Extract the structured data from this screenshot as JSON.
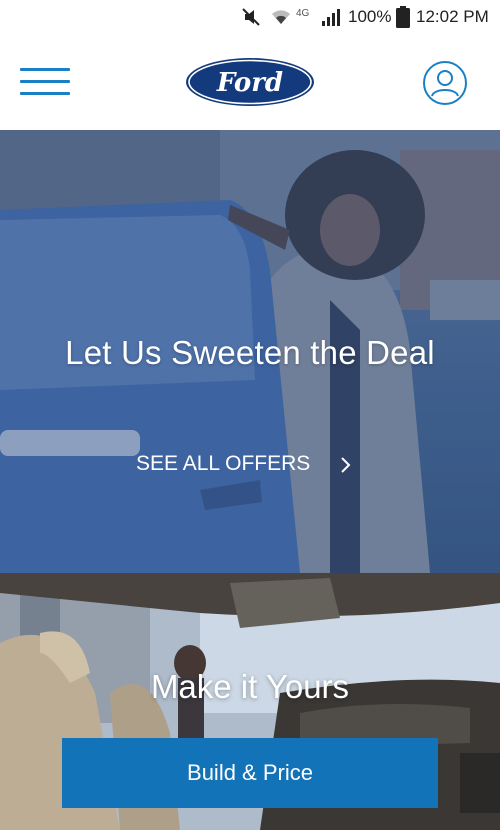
{
  "status_bar": {
    "network_label": "4G",
    "battery_percent": "100%",
    "time": "12:02 PM",
    "icons": [
      "mute-icon",
      "wifi-icon",
      "signal-icon",
      "battery-icon"
    ]
  },
  "header": {
    "logo_text": "Ford",
    "icons": [
      "menu-icon",
      "account-icon"
    ],
    "brand_color": "#1a80c4",
    "logo_color": "#133a7c"
  },
  "hero_offers": {
    "title": "Let Us Sweeten the Deal",
    "link_label": "SEE ALL OFFERS",
    "link_icon": "chevron-right-icon"
  },
  "hero_build": {
    "title": "Make it Yours",
    "button_label": "Build & Price",
    "button_color": "#1373b8"
  }
}
